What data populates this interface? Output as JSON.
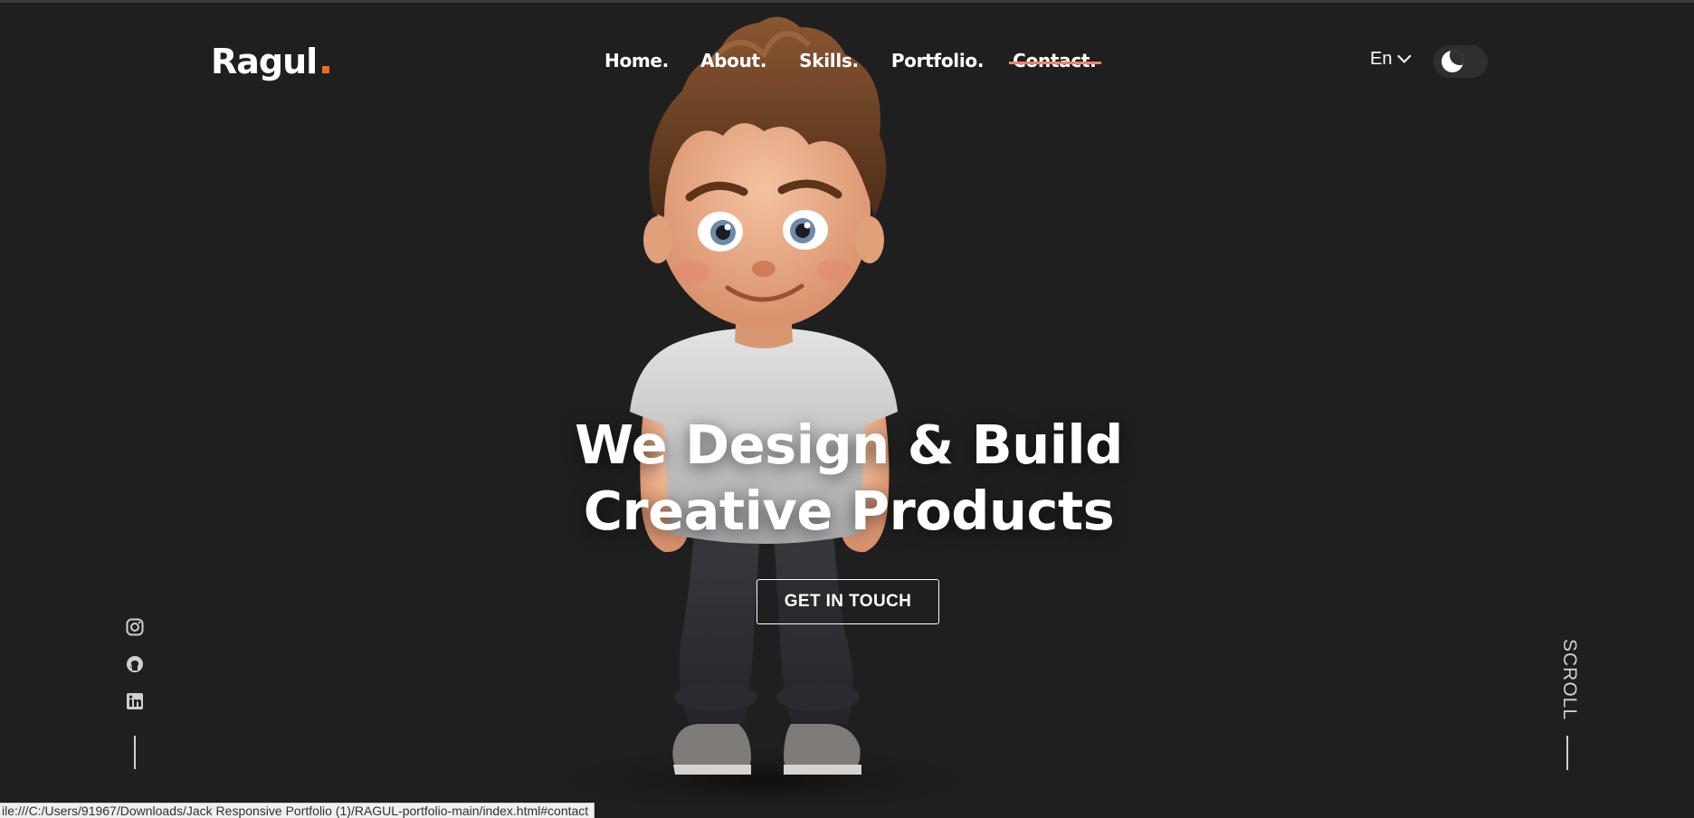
{
  "header": {
    "logo": "Ragul",
    "nav": [
      {
        "label": "Home."
      },
      {
        "label": "About."
      },
      {
        "label": "Skills."
      },
      {
        "label": "Portfolio."
      },
      {
        "label": "Contact."
      }
    ],
    "language": "En",
    "theme_toggle_icon": "moon-icon"
  },
  "hero": {
    "title_line1": "We Design & Build",
    "title_line2": "Creative Products",
    "cta_label": "GET IN TOUCH"
  },
  "social": {
    "icons": [
      "instagram-icon",
      "github-icon",
      "linkedin-icon"
    ]
  },
  "scroll_label": "SCROLL",
  "status_bar": {
    "url": "ile:///C:/Users/91967/Downloads/Jack Responsive Portfolio (1)/RAGUL-portfolio-main/index.html#contact"
  },
  "colors": {
    "background": "#1f1f1f",
    "accent": "#f26b1d",
    "text": "#ffffff"
  }
}
